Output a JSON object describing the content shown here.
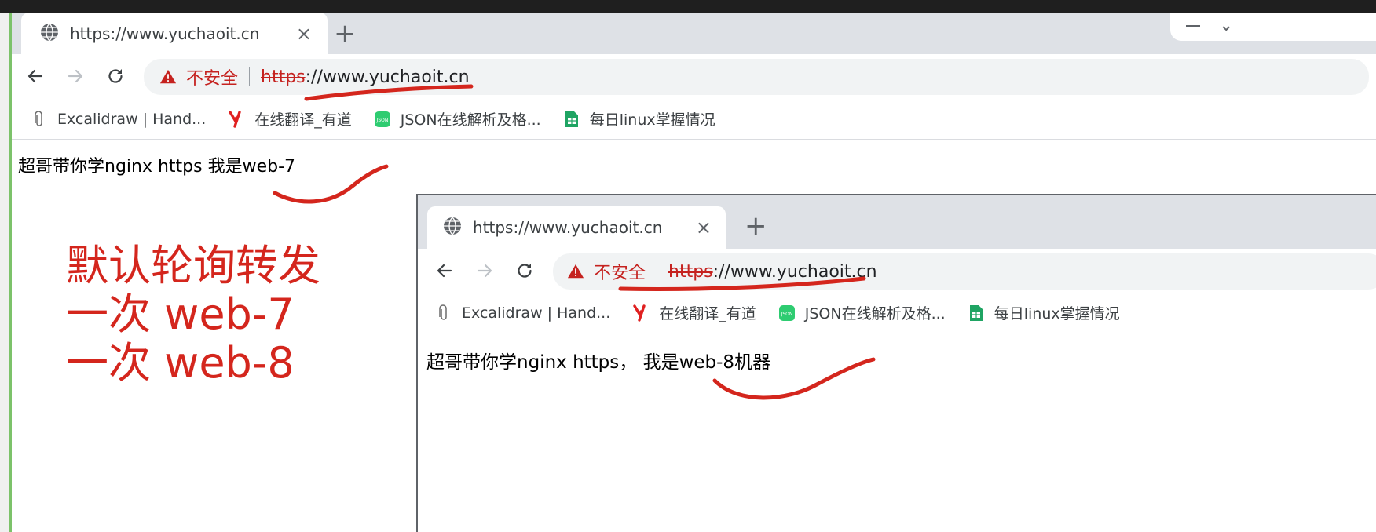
{
  "window_back": {
    "tab": {
      "title": "https://www.yuchaoit.cn",
      "close_glyph": "×",
      "icon": "globe-icon"
    },
    "new_tab_glyph": "+",
    "omnibox": {
      "security_label": "不安全",
      "url_scheme": "https",
      "url_rest": "://www.yuchaoit.cn"
    },
    "bookmarks": [
      {
        "label": "Excalidraw | Hand...",
        "icon": "paperclip-icon"
      },
      {
        "label": "在线翻译_有道",
        "icon": "youdao-icon"
      },
      {
        "label": "JSON在线解析及格...",
        "icon": "json-icon"
      },
      {
        "label": "每日linux掌握情况",
        "icon": "sheets-icon"
      }
    ],
    "content": "超哥带你学nginx https 我是web-7"
  },
  "window_front": {
    "tab": {
      "title": "https://www.yuchaoit.cn",
      "close_glyph": "×",
      "icon": "globe-icon"
    },
    "new_tab_glyph": "+",
    "omnibox": {
      "security_label": "不安全",
      "url_scheme": "https",
      "url_rest": "://www.yuchaoit.cn"
    },
    "bookmarks": [
      {
        "label": "Excalidraw | Hand...",
        "icon": "paperclip-icon"
      },
      {
        "label": "在线翻译_有道",
        "icon": "youdao-icon"
      },
      {
        "label": "JSON在线解析及格...",
        "icon": "json-icon"
      },
      {
        "label": "每日linux掌握情况",
        "icon": "sheets-icon"
      }
    ],
    "content": "超哥带你学nginx https， 我是web-8机器"
  },
  "annotation": {
    "lines": [
      "默认轮询转发",
      "一次 web-7",
      "一次 web-8"
    ],
    "color": "#d4261d"
  },
  "colors": {
    "tabstrip": "#dee1e6",
    "omnibox": "#f1f3f4",
    "insecure": "#c5221f"
  }
}
